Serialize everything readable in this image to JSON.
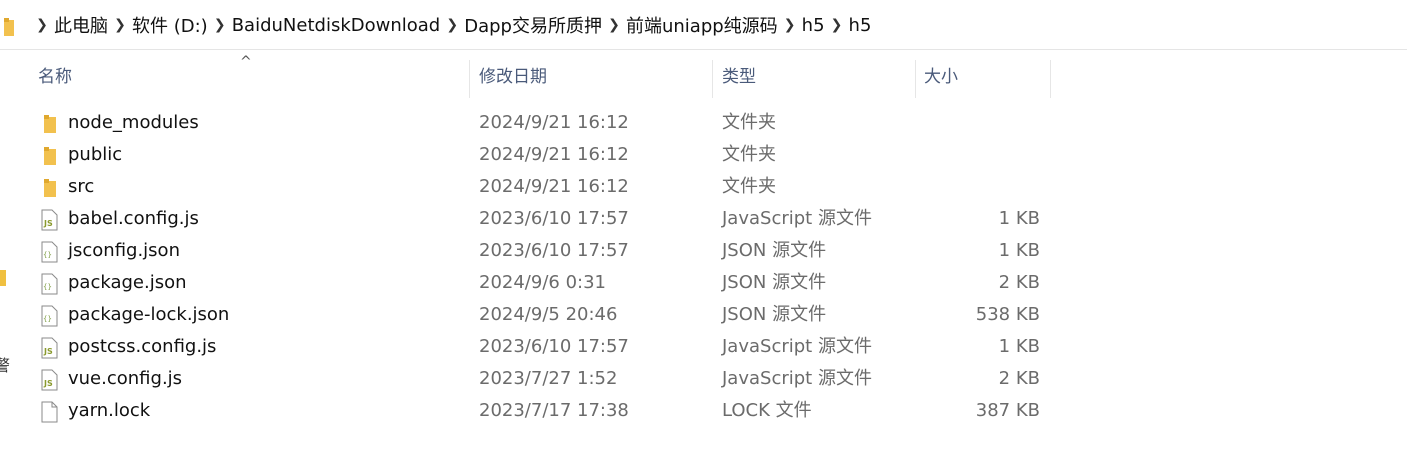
{
  "address": {
    "crumbs": [
      {
        "label": "此电脑"
      },
      {
        "label": "软件 (D:)"
      },
      {
        "label": "BaiduNetdiskDownload"
      },
      {
        "label": "Dapp交易所质押"
      },
      {
        "label": "前端uniapp纯源码"
      },
      {
        "label": "h5"
      },
      {
        "label": "h5"
      }
    ],
    "separator": ">"
  },
  "left_pane": {
    "edge_text": "警"
  },
  "columns": {
    "sort_indicator": "^",
    "name": "名称",
    "date": "修改日期",
    "type": "类型",
    "size": "大小"
  },
  "files": [
    {
      "name": "node_modules",
      "date": "2024/9/21 16:12",
      "type": "文件夹",
      "size": "",
      "icon": "folder-icon"
    },
    {
      "name": "public",
      "date": "2024/9/21 16:12",
      "type": "文件夹",
      "size": "",
      "icon": "folder-icon"
    },
    {
      "name": "src",
      "date": "2024/9/21 16:12",
      "type": "文件夹",
      "size": "",
      "icon": "folder-icon"
    },
    {
      "name": "babel.config.js",
      "date": "2023/6/10 17:57",
      "type": "JavaScript 源文件",
      "size": "1 KB",
      "icon": "js-file-icon"
    },
    {
      "name": "jsconfig.json",
      "date": "2023/6/10 17:57",
      "type": "JSON 源文件",
      "size": "1 KB",
      "icon": "json-file-icon"
    },
    {
      "name": "package.json",
      "date": "2024/9/6 0:31",
      "type": "JSON 源文件",
      "size": "2 KB",
      "icon": "json-file-icon"
    },
    {
      "name": "package-lock.json",
      "date": "2024/9/5 20:46",
      "type": "JSON 源文件",
      "size": "538 KB",
      "icon": "json-file-icon"
    },
    {
      "name": "postcss.config.js",
      "date": "2023/6/10 17:57",
      "type": "JavaScript 源文件",
      "size": "1 KB",
      "icon": "js-file-icon"
    },
    {
      "name": "vue.config.js",
      "date": "2023/7/27 1:52",
      "type": "JavaScript 源文件",
      "size": "2 KB",
      "icon": "js-file-icon"
    },
    {
      "name": "yarn.lock",
      "date": "2023/7/17 17:38",
      "type": "LOCK 文件",
      "size": "387 KB",
      "icon": "generic-file-icon"
    }
  ],
  "colors": {
    "folder": "#f2c14e",
    "folder_dark": "#e0a82e",
    "js_badge": "#8a9a2e",
    "json_badge": "#7a9a3e"
  }
}
